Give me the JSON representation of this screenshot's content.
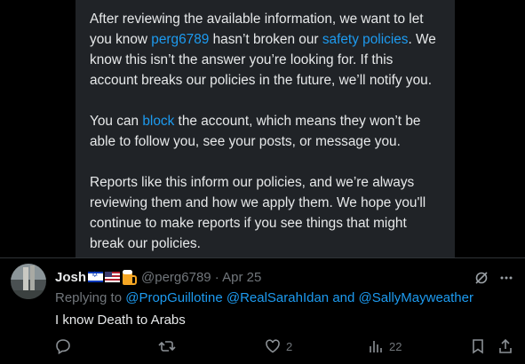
{
  "notice": {
    "p1_a": "After reviewing the available information, we want to let you know ",
    "p1_user": "perg6789",
    "p1_b": " hasn’t broken our ",
    "p1_link": "safety policies",
    "p1_c": ". We know this isn’t the answer you’re looking for. If this account breaks our policies in the future, we’ll notify you.",
    "p2_a": "You can ",
    "p2_link": "block",
    "p2_b": " the account, which means they won’t be able to follow you, see your posts, or message you.",
    "p3": "Reports like this inform our policies, and we’re always reviewing them and how we apply them. We hope you'll continue to make reports if you see things that might break our policies."
  },
  "tweet": {
    "display_name": "Josh",
    "handle_date": "@perg6789 · Apr 25",
    "replying_prefix": "Replying to ",
    "mention1": "@PropGuillotine",
    "mention2": "@RealSarahIdan",
    "and_word": " and ",
    "mention3": "@SallyMayweather",
    "text": "I know Death to Arabs",
    "likes": "2",
    "views": "22"
  },
  "colors": {
    "link": "#1d9bf0",
    "muted": "#71767b",
    "card_bg": "#202327",
    "bg": "#000000"
  }
}
